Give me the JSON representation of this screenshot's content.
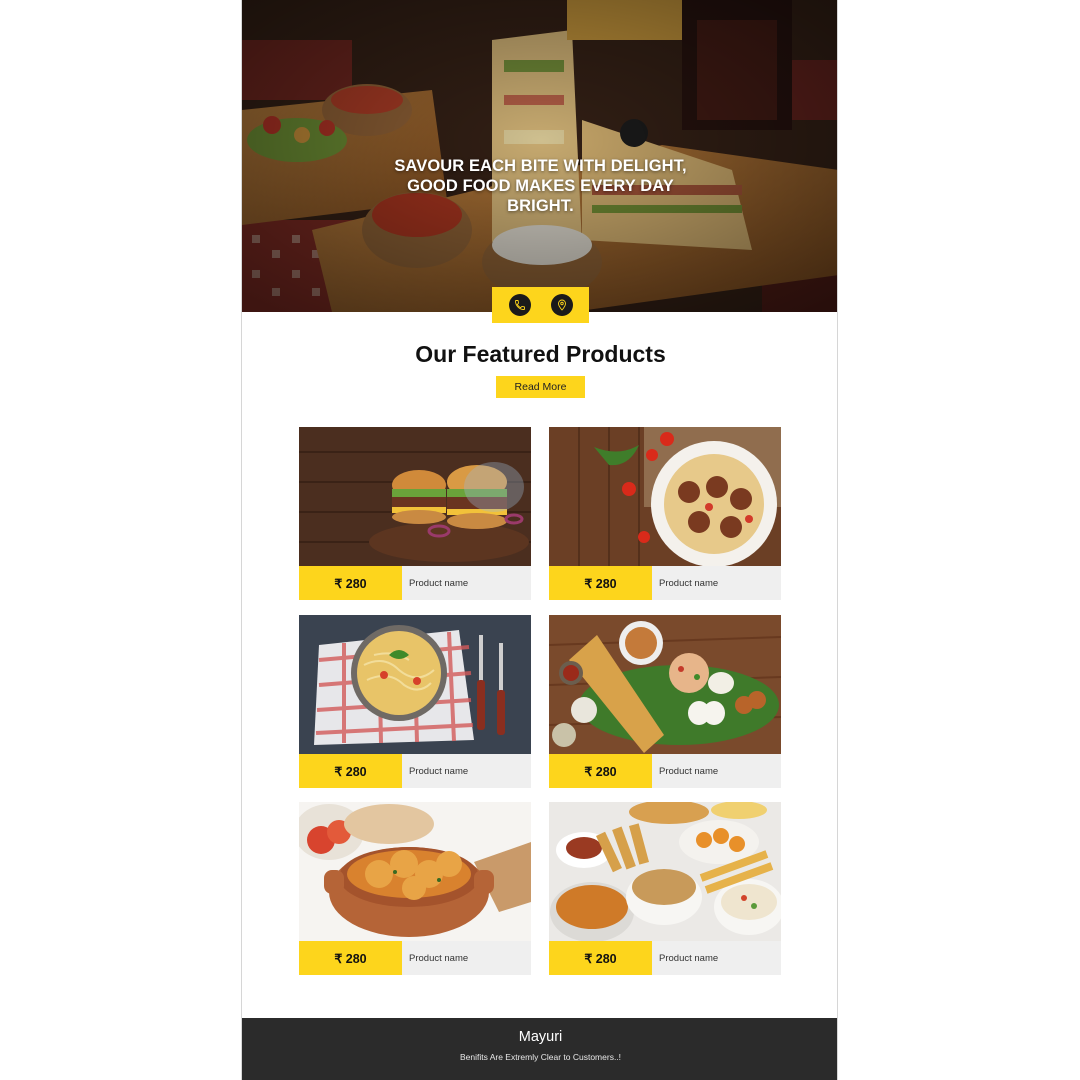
{
  "hero": {
    "title_lines": [
      "SAVOUR EACH BITE WITH DELIGHT,",
      "GOOD FOOD MAKES EVERY DAY",
      "BRIGHT."
    ],
    "icons": [
      "phone-icon",
      "location-pin-icon"
    ]
  },
  "featured": {
    "title": "Our Featured Products",
    "read_more_label": "Read More"
  },
  "products": [
    {
      "price": "₹ 280",
      "name": "Product name",
      "photo": "burgers"
    },
    {
      "price": "₹ 280",
      "name": "Product name",
      "photo": "pasta-meatballs"
    },
    {
      "price": "₹ 280",
      "name": "Product name",
      "photo": "noodles"
    },
    {
      "price": "₹ 280",
      "name": "Product name",
      "photo": "dosa-thali"
    },
    {
      "price": "₹ 280",
      "name": "Product name",
      "photo": "dum-aloo"
    },
    {
      "price": "₹ 280",
      "name": "Product name",
      "photo": "snacks-platter"
    }
  ],
  "footer": {
    "brand": "Mayuri",
    "tagline": "Benifits Are Extremly Clear to Customers..!"
  },
  "colors": {
    "accent": "#fdd51c",
    "footer_bg": "#2b2b2b",
    "name_bg": "#efefef"
  }
}
